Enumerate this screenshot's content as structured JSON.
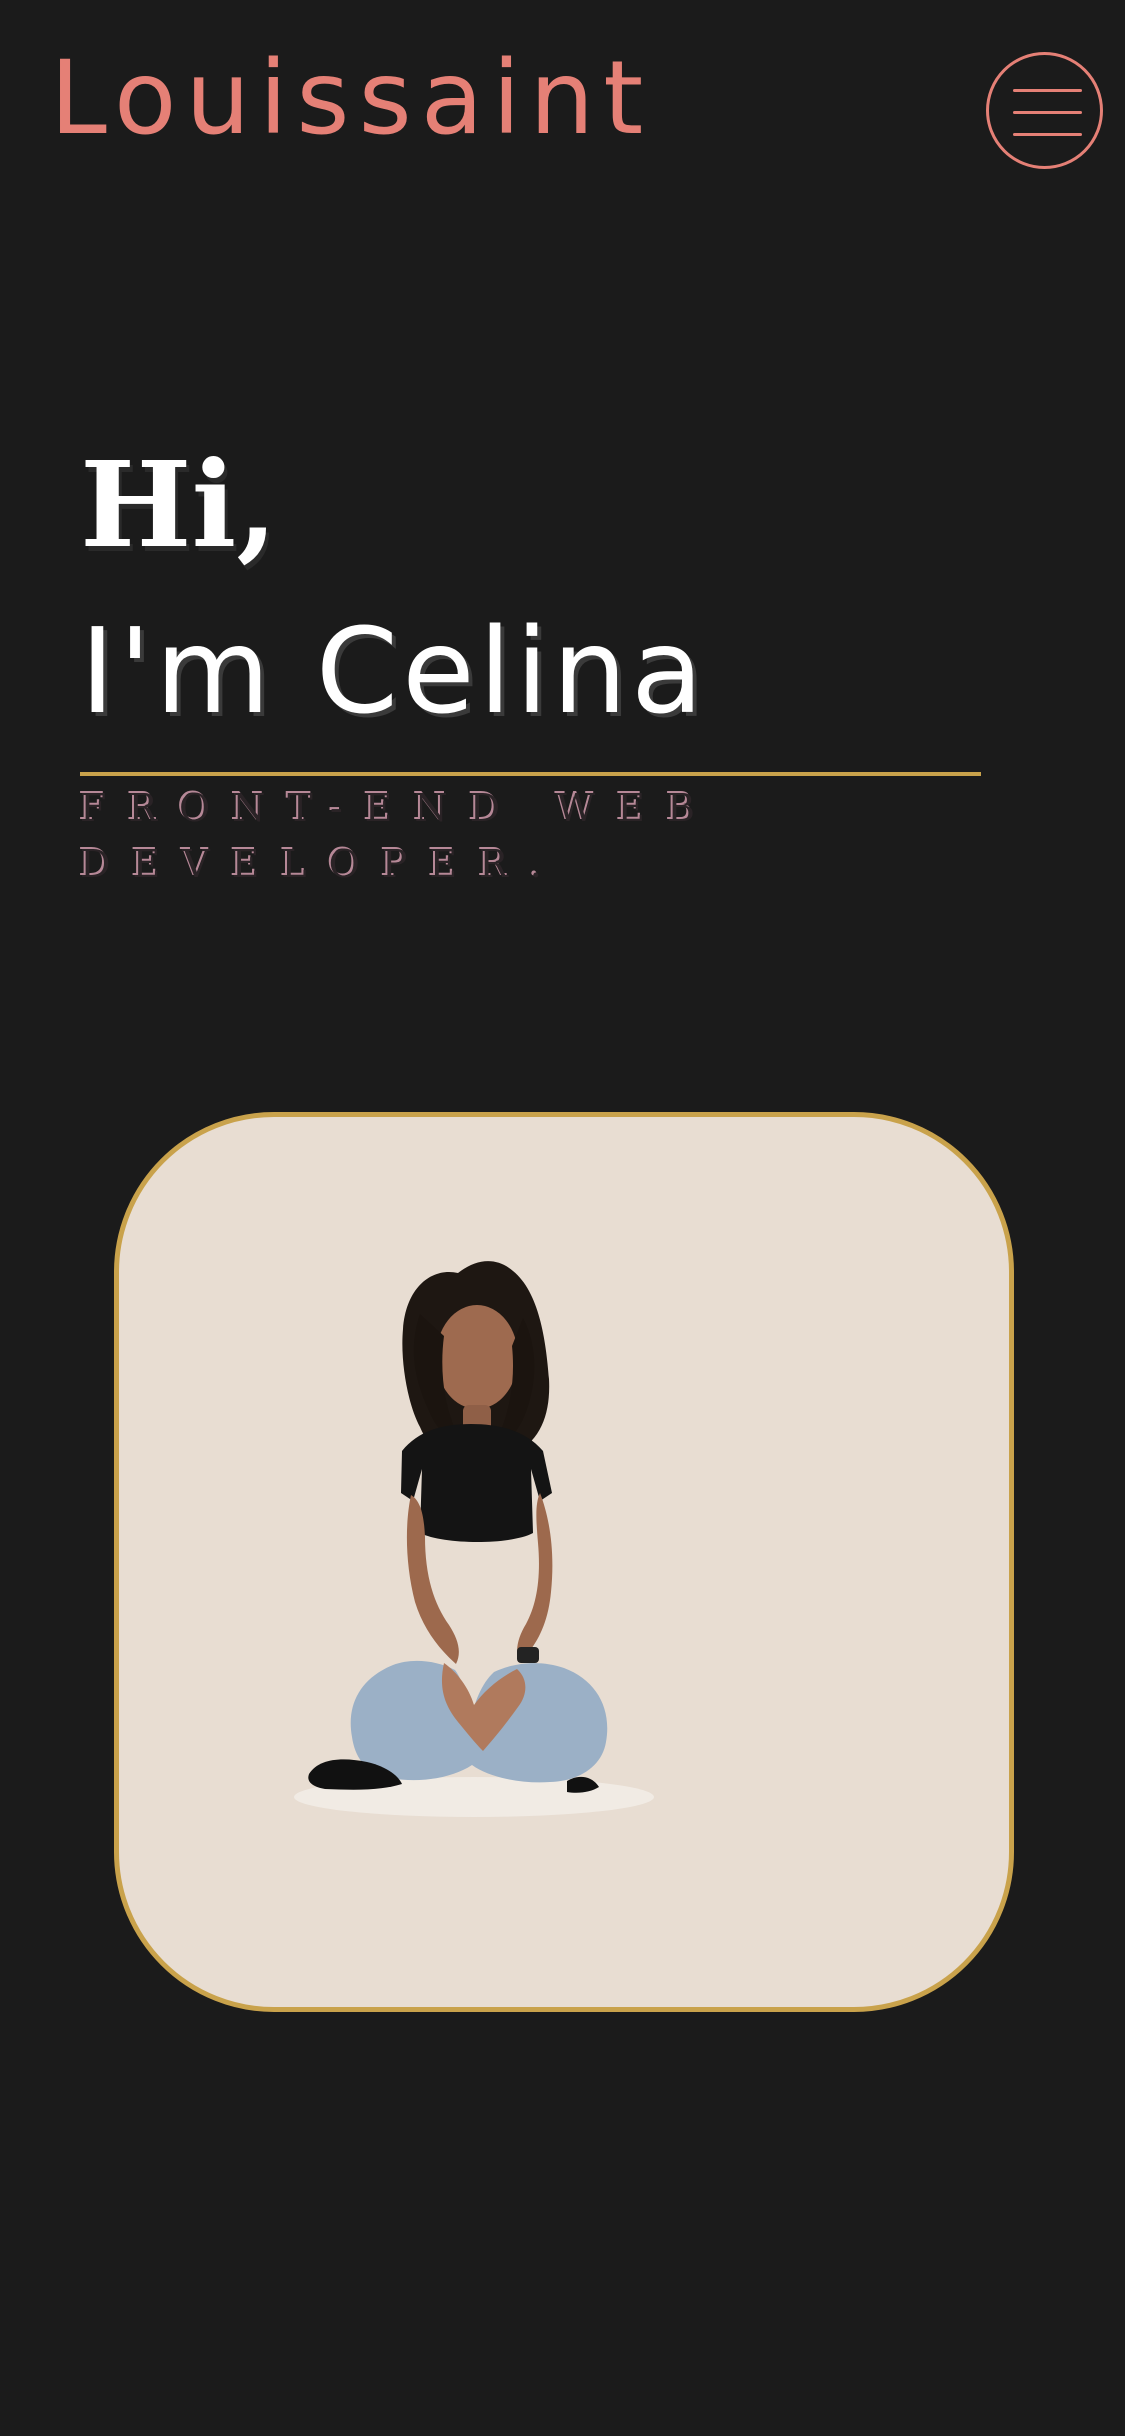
{
  "header": {
    "brand": "Louissaint",
    "menu_icon": "hamburger-menu-icon"
  },
  "hero": {
    "greeting": "Hi,",
    "name": "I'm Celina",
    "role_line_1": "FRONT-END WEB",
    "role_line_2": "DEVELOPER."
  },
  "photo": {
    "subject": "profile-photo"
  },
  "colors": {
    "background": "#1b1b1b",
    "brand": "#e58076",
    "accent": "#c9a24b",
    "card": "#e8ddd2",
    "text": "#ffffff",
    "role": "#b68897"
  }
}
